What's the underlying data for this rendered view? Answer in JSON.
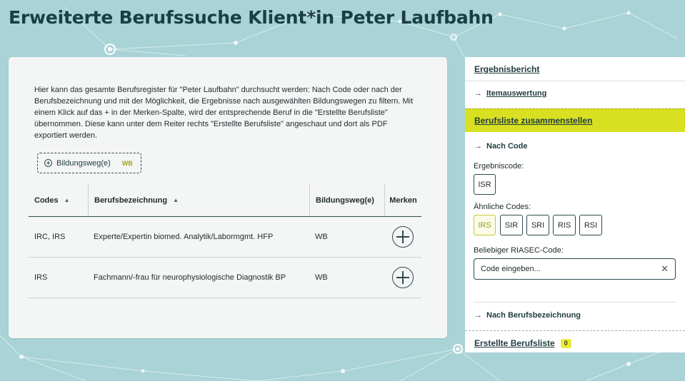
{
  "page": {
    "title": "Erweiterte Berufssuche Klient*in Peter Laufbahn"
  },
  "colors": {
    "background": "#a9d3d6",
    "accent": "#d9e021",
    "dark": "#1f3b3e"
  },
  "main": {
    "intro": "Hier kann das gesamte Berufsregister für \"Peter Laufbahn\" durchsucht werden: Nach Code oder nach der Berufsbezeichnung und mit der Möglichkeit, die Ergebnisse nach ausgewählten Bildungswegen zu filtern. Mit einem Klick auf das + in der Merken-Spalte, wird der entsprechende Beruf in die \"Erstellte Berufsliste\" übernommen. Diese kann unter dem Reiter rechts \"Erstellte Berufsliste\" angeschaut und dort als PDF exportiert werden.",
    "filter": {
      "label": "Bildungsweg(e)",
      "tag": "WB",
      "icon": "plus-circle-icon"
    },
    "table": {
      "headers": {
        "codes": "Codes",
        "berufsbezeichnung": "Berufsbezeichnung",
        "bildungsweg": "Bildungsweg(e)",
        "merken": "Merken"
      },
      "rows": [
        {
          "codes": "IRC, IRS",
          "beruf": "Experte/Expertin biomed. Analytik/Labormgmt. HFP",
          "bildungsweg": "WB"
        },
        {
          "codes": "IRS",
          "beruf": "Fachmann/-frau für neurophysiologische Diagnostik BP",
          "bildungsweg": "WB"
        }
      ]
    }
  },
  "sidebar": {
    "ergebnisbericht": "Ergebnisbericht",
    "itemauswertung": "Itemauswertung",
    "berufsliste_zusammenstellen": "Berufsliste zusammenstellen",
    "nach_code": "Nach Code",
    "ergebniscode_label": "Ergebniscode:",
    "ergebniscode": "ISR",
    "aehnliche_label": "Ähnliche Codes:",
    "aehnliche_codes": [
      "IRS",
      "SIR",
      "SRI",
      "RIS",
      "RSI"
    ],
    "selected_code": "IRS",
    "riasec_label": "Beliebiger RIASEC-Code:",
    "riasec_placeholder": "Code eingeben...",
    "nach_berufsbezeichnung": "Nach Berufsbezeichnung",
    "erstellte_berufsliste": "Erstellte Berufsliste",
    "erstellte_count": "0"
  }
}
